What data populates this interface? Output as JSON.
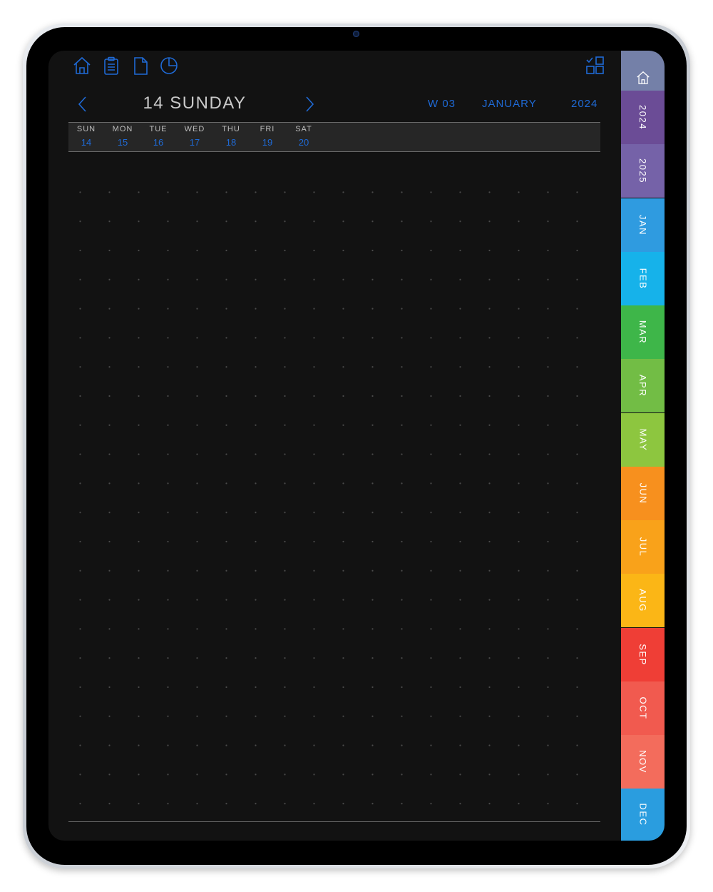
{
  "toolbar": {
    "icons": [
      "home-icon",
      "clipboard-icon",
      "page-icon",
      "pie-chart-icon"
    ],
    "right_icon": "checklist-grid-icon"
  },
  "header": {
    "date_title": "14 SUNDAY",
    "week": "W 03",
    "month": "JANUARY",
    "year": "2024",
    "prev": "chevron-left-icon",
    "next": "chevron-right-icon"
  },
  "week_days": [
    {
      "name": "SUN",
      "date": "14"
    },
    {
      "name": "MON",
      "date": "15"
    },
    {
      "name": "TUE",
      "date": "16"
    },
    {
      "name": "WED",
      "date": "17"
    },
    {
      "name": "THU",
      "date": "18"
    },
    {
      "name": "FRI",
      "date": "19"
    },
    {
      "name": "SAT",
      "date": "20"
    }
  ],
  "side_tabs": [
    {
      "label": "",
      "icon": "home-icon",
      "color": "#7480a8"
    },
    {
      "label": "2024",
      "color": "#6b4c96"
    },
    {
      "label": "2025",
      "color": "#7562a8"
    },
    {
      "label": "JAN",
      "color": "#2f9be0"
    },
    {
      "label": "FEB",
      "color": "#16b2ea"
    },
    {
      "label": "MAR",
      "color": "#3eb649"
    },
    {
      "label": "APR",
      "color": "#72bd45"
    },
    {
      "label": "MAY",
      "color": "#8dc63f"
    },
    {
      "label": "JUN",
      "color": "#f7901e"
    },
    {
      "label": "JUL",
      "color": "#f9a21a"
    },
    {
      "label": "AUG",
      "color": "#fbb616"
    },
    {
      "label": "SEP",
      "color": "#ef3e36"
    },
    {
      "label": "OCT",
      "color": "#f15a4f"
    },
    {
      "label": "NOV",
      "color": "#f36c5c"
    },
    {
      "label": "DEC",
      "color": "#2a9ddf"
    }
  ],
  "colors": {
    "accent": "#1f6ad6",
    "screen_bg": "#121212",
    "strip_bg": "#262626"
  }
}
